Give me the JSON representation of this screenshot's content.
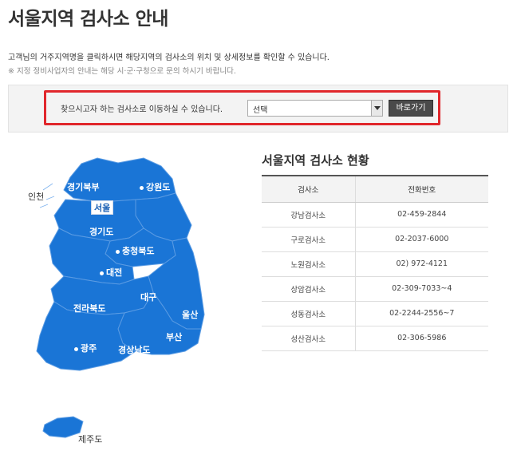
{
  "page": {
    "title": "서울지역 검사소 안내",
    "intro": "고객님의 거주지역명을 클릭하시면 해당지역의 검사소의 위치 및 상세정보를 확인할 수 있습니다.",
    "note": "※ 지정 정비사업자의 안내는 해당 시·군·구청으로 문의 하시기 바랍니다."
  },
  "search": {
    "label": "찾으시고자 하는 검사소로 이동하실 수 있습니다.",
    "select_value": "선택",
    "button_label": "바로가기",
    "highlight_color": "#e0262b"
  },
  "map": {
    "fill_color": "#1a75d6",
    "regions": {
      "incheon": "인천",
      "gyeonggi_north": "경기북부",
      "gangwon": "강원도",
      "seoul": "서울",
      "gyeonggi": "경기도",
      "chungbuk": "충청북도",
      "daejeon": "대전",
      "daegu": "대구",
      "ulsan": "울산",
      "jeonbuk": "전라북도",
      "busan": "부산",
      "gwangju": "광주",
      "gyeongnam": "경상남도",
      "jeju": "제주도"
    }
  },
  "status": {
    "title": "서울지역 검사소 현황",
    "columns": [
      "검사소",
      "전화번호"
    ],
    "rows": [
      {
        "name": "강남검사소",
        "phone": "02-459-2844"
      },
      {
        "name": "구로검사소",
        "phone": "02-2037-6000"
      },
      {
        "name": "노원검사소",
        "phone": "02) 972-4121"
      },
      {
        "name": "상암검사소",
        "phone": "02-309-7033~4"
      },
      {
        "name": "성동검사소",
        "phone": "02-2244-2556~7"
      },
      {
        "name": "성산검사소",
        "phone": "02-306-5986"
      }
    ]
  }
}
